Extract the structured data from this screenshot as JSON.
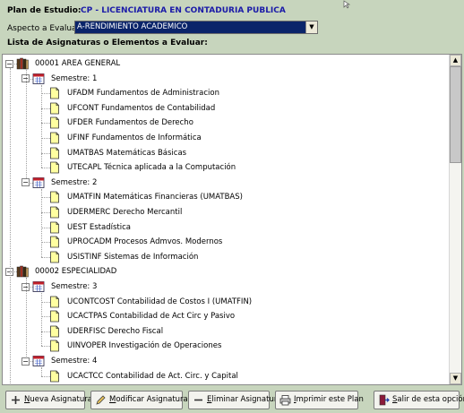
{
  "header": {
    "plan_label": "Plan de Estudio:",
    "plan_value": "CP - LICENCIATURA EN CONTADURIA PUBLICA",
    "aspecto_label": "Aspecto a Evaluar",
    "aspecto_value": "A-RENDIMIENTO ACADEMICO",
    "lista_label": "Lista de Asignaturas o Elementos a Evaluar:"
  },
  "tree": {
    "areas": [
      {
        "label": "00001 AREA GENERAL",
        "semesters": [
          {
            "label": "Semestre: 1",
            "subjects": [
              "UFADM Fundamentos de Administracion",
              "UFCONT Fundamentos de Contabilidad",
              "UFDER Fundamentos de Derecho",
              "UFINF Fundamentos de Informática",
              "UMATBAS Matemáticas Básicas",
              "UTECAPL Técnica aplicada a la Computación"
            ]
          },
          {
            "label": "Semestre: 2",
            "subjects": [
              "UMATFIN Matemáticas Financieras (UMATBAS)",
              "UDERMERC Derecho Mercantil",
              "UEST Estadística",
              "UPROCADM Procesos Admvos. Modernos",
              "USISTINF Sistemas de Información"
            ]
          }
        ]
      },
      {
        "label": "00002 ESPECIALIDAD",
        "semesters": [
          {
            "label": "Semestre: 3",
            "subjects": [
              "UCONTCOST Contabilidad de Costos I (UMATFIN)",
              "UCACTPAS Contabilidad de Act Circ y Pasivo",
              "UDERFISC Derecho Fiscal",
              "UINVOPER Investigación de Operaciones"
            ]
          },
          {
            "label": "Semestre: 4",
            "subjects": [
              "UCACTCC Contabilidad de Act. Circ. y Capital"
            ]
          }
        ]
      }
    ]
  },
  "buttons": {
    "nueva": {
      "u": "N",
      "rest": "ueva Asignatura"
    },
    "modificar": {
      "u": "M",
      "rest": "odificar Asignatura"
    },
    "eliminar": {
      "u": "E",
      "rest": "liminar Asignatura"
    },
    "imprimir": {
      "u": "I",
      "rest": "mprimir este Plan"
    },
    "salir": {
      "u": "S",
      "rest": "alir de esta opción"
    }
  },
  "colors": {
    "background": "#c7d5bd",
    "plan_value": "#1a1aa8",
    "select_bg": "#0a246a"
  }
}
